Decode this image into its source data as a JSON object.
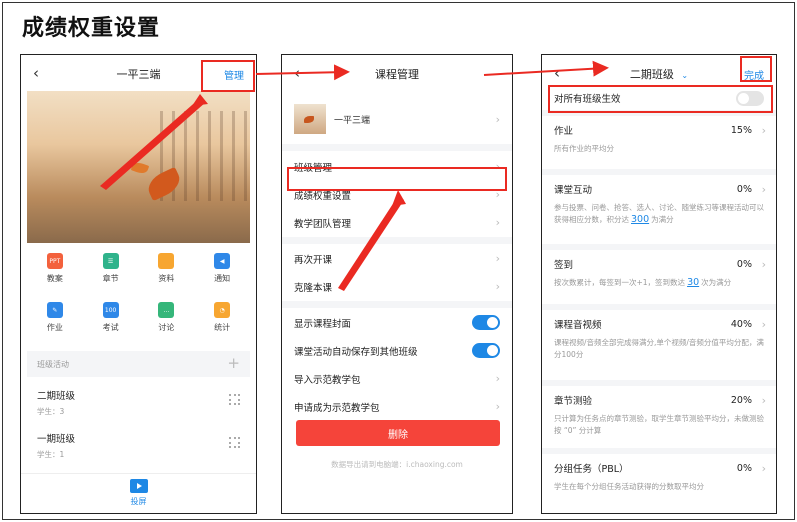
{
  "page_title": "成绩权重设置",
  "phone1": {
    "nav_title": "一平三端",
    "manage": "管理",
    "grid": [
      {
        "icon": "ppt-icon",
        "glyph": "PPT",
        "color": "#f3613d",
        "label": "教案"
      },
      {
        "icon": "chapter-icon",
        "glyph": "☰",
        "color": "#2fb38b",
        "label": "章节"
      },
      {
        "icon": "folder-icon",
        "glyph": "",
        "color": "#f7a631",
        "label": "资料"
      },
      {
        "icon": "speaker-icon",
        "glyph": "◀",
        "color": "#2f88e8",
        "label": "通知"
      },
      {
        "icon": "homework-icon",
        "glyph": "✎",
        "color": "#2f88e8",
        "label": "作业"
      },
      {
        "icon": "exam-icon",
        "glyph": "100",
        "color": "#2f88e8",
        "label": "考试"
      },
      {
        "icon": "discuss-icon",
        "glyph": "…",
        "color": "#35b67a",
        "label": "讨论"
      },
      {
        "icon": "stats-icon",
        "glyph": "◔",
        "color": "#f7a631",
        "label": "统计"
      }
    ],
    "section_label": "班级活动",
    "classes": [
      {
        "name": "二期班级",
        "students": "学生：3"
      },
      {
        "name": "一期班级",
        "students": "学生：1"
      }
    ],
    "bottom_label": "投屏"
  },
  "phone2": {
    "nav_title": "课程管理",
    "course_name": "一平三端",
    "rows": {
      "class_manage": "班级管理",
      "grade_weight": "成绩权重设置",
      "team_manage": "教学团队管理",
      "reopen": "再次开课",
      "clone": "克隆本课",
      "show_cover": "显示课程封面",
      "auto_save": "课堂活动自动保存到其他班级",
      "import_pack": "导入示范教学包",
      "apply_pack": "申请成为示范教学包"
    },
    "delete_label": "删除",
    "export_note": "数据导出请到电脑端：i.chaoxing.com"
  },
  "phone3": {
    "nav_title": "二期班级",
    "done": "完成",
    "apply_all": "对所有班级生效",
    "items": [
      {
        "name": "作业",
        "pct": "15%",
        "desc_a": "所有作业的平均分",
        "num": "",
        "desc_b": ""
      },
      {
        "name": "课堂互动",
        "pct": "0%",
        "desc_a": "参与投票、问卷、抢答、选人、讨论、随堂练习等课程活动可以获得相应分数，积分达",
        "num": "300",
        "desc_b": "为满分"
      },
      {
        "name": "签到",
        "pct": "0%",
        "desc_a": "按次数累计，每签到一次+1，签到数达",
        "num": "30",
        "desc_b": "次为满分"
      },
      {
        "name": "课程音视频",
        "pct": "40%",
        "desc_a": "课程视频/音频全部完成得满分,单个视频/音频分值平均分配，满分100分",
        "num": "",
        "desc_b": ""
      },
      {
        "name": "章节测验",
        "pct": "20%",
        "desc_a": "只计算为任务点的章节测验，取学生章节测验平均分，未做测验按 “0” 分计算",
        "num": "",
        "desc_b": ""
      },
      {
        "name": "分组任务（PBL）",
        "pct": "0%",
        "desc_a": "学生在每个分组任务活动获得的分数取平均分",
        "num": "",
        "desc_b": ""
      }
    ]
  }
}
